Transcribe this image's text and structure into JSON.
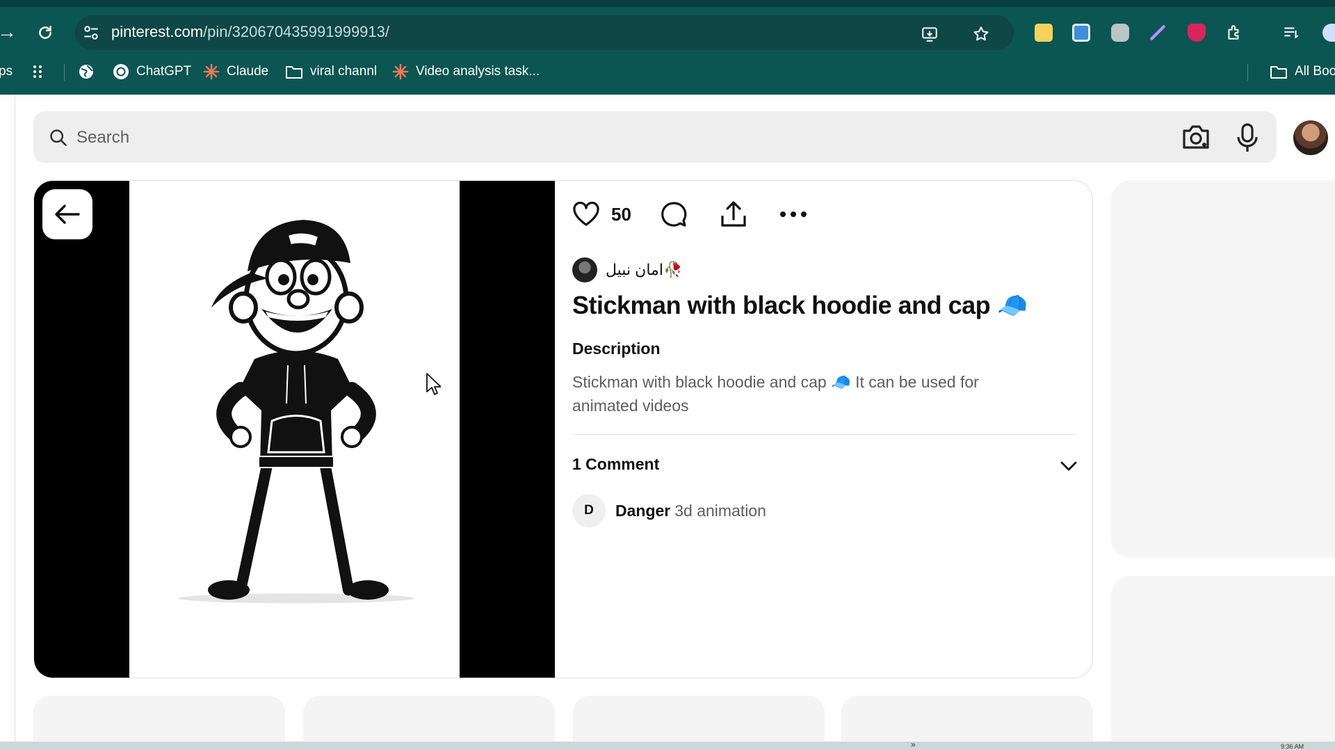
{
  "browser": {
    "url_host": "pinterest.com",
    "url_path": "/pin/320670435991999913/",
    "bookmarks": [
      {
        "label": "ps",
        "icon": "apps-icon"
      },
      {
        "label": "ChatGPT",
        "icon": "chatgpt-icon"
      },
      {
        "label": "Claude",
        "icon": "claude-icon"
      },
      {
        "label": "viral channl",
        "icon": "folder-icon"
      },
      {
        "label": "Video analysis task...",
        "icon": "claude-icon"
      },
      {
        "label": "All Boo",
        "icon": "folder-icon"
      }
    ],
    "accent": "#0b5552"
  },
  "search": {
    "placeholder": "Search"
  },
  "pin": {
    "like_count": "50",
    "author_name": "امان نبیل🥀",
    "title": "Stickman with black hoodie and cap 🧢",
    "description_heading": "Description",
    "description": "Stickman with black hoodie and cap 🧢 It can be used for animated videos",
    "comments_heading": "1 Comment",
    "comments": [
      {
        "initial": "D",
        "author": "Danger",
        "text": "3d animation"
      }
    ]
  },
  "taskbar": {
    "overflow": "»",
    "clock": "9:36 AM"
  }
}
